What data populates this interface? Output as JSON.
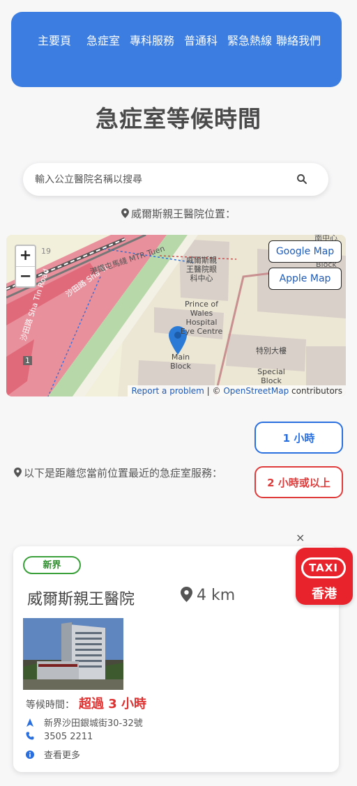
{
  "nav": {
    "items": [
      {
        "label": "主要頁"
      },
      {
        "label": "急症室"
      },
      {
        "label": "專科服務"
      },
      {
        "label": "普通科"
      },
      {
        "label": "緊急熱線"
      },
      {
        "label": "聯絡我們"
      }
    ]
  },
  "page_title": "急症室等候時間",
  "search": {
    "placeholder": "輸入公立醫院名稱以搜尋"
  },
  "location_label": "威爾斯親王醫院位置：",
  "map": {
    "google_btn": "Google Map",
    "apple_btn": "Apple Map",
    "zoom_in": "+",
    "zoom_out": "−",
    "report": "Report a problem",
    "osm_sep": " | © ",
    "osm": "OpenStreetMap",
    "contributors": " contributors",
    "labels": {
      "eye_centre_zh": "威爾斯親王醫院眼科中心",
      "eye_centre_en": "Prince of Wales Hospital Eye Centre",
      "main_block_en": "Main Block",
      "special_block_zh": "特別大樓",
      "special_block_en": "Special Block",
      "road_shatin": "沙田路 Sha Tin Road",
      "road_shatin_top": "沙田路 Sha Ti",
      "rail": "港鐵屯馬綫 MTR Tuen",
      "badge_1": "1",
      "num_19": "19",
      "top_right": "南中心",
      "block": "Block"
    }
  },
  "filters": {
    "one_hour": "1 小時",
    "two_hour": "2 小時或以上"
  },
  "nearest_label": "以下是距離您當前位置最近的急症室服務：",
  "close": "×",
  "card": {
    "region": "新界",
    "name": "威爾斯親王醫院",
    "distance": "4 km",
    "wait_label": "等候時間：",
    "wait_value": "超過 3 小時",
    "address": "新界沙田銀城街30-32號",
    "phone": "3505 2211",
    "more": "查看更多"
  },
  "taxi": {
    "badge": "TAXI",
    "hk": "香港"
  },
  "colors": {
    "nav_bg": "#3b7de0",
    "one_hour": "#2a6fe0",
    "two_hour": "#e03b3b",
    "region_green": "#3aa03a",
    "wait_red": "#e03131",
    "taxi_red": "#e8232c"
  },
  "icons": [
    "search-icon",
    "map-pin-icon",
    "navigation-arrow-icon",
    "phone-icon",
    "info-icon",
    "close-icon"
  ]
}
